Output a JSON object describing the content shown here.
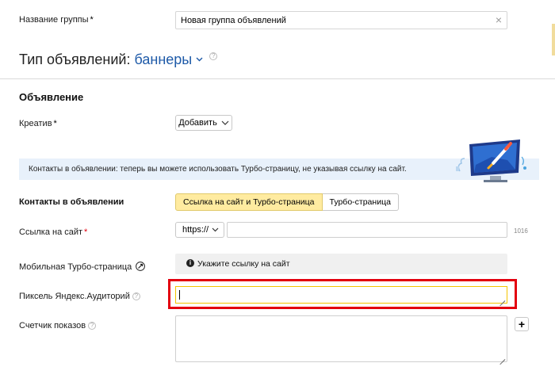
{
  "group": {
    "label": "Название группы",
    "required_mark": "*",
    "value": "Новая группа объявлений",
    "clear_glyph": "×"
  },
  "ad_type": {
    "prefix": "Тип объявлений:",
    "value": "баннеры",
    "help": "?"
  },
  "ad_section_title": "Объявление",
  "creative": {
    "label": "Креатив",
    "required_mark": "*",
    "add_button": "Добавить"
  },
  "info_banner": {
    "text": "Контакты в объявлении: теперь вы можете использовать Турбо-страницу, не указывая ссылку на сайт."
  },
  "contacts": {
    "label": "Контакты в объявлении",
    "tabs": [
      {
        "label": "Ссылка на сайт и Турбо-страница",
        "active": true
      },
      {
        "label": "Турбо-страница",
        "active": false
      }
    ]
  },
  "site_link": {
    "label": "Ссылка на сайт",
    "required_mark": "*",
    "protocol": "https://",
    "value": "",
    "counter": "1016"
  },
  "turbo_page": {
    "label": "Мобильная Турбо-страница",
    "icon": "rocket-icon",
    "notice": "Укажите ссылку на сайт"
  },
  "pixel": {
    "label": "Пиксель Яндекс.Аудиторий",
    "help": "?",
    "value": ""
  },
  "counter": {
    "label": "Счетчик показов",
    "help": "?",
    "value": "",
    "add_glyph": "+"
  },
  "colors": {
    "highlight_border": "#e3000f",
    "active_tab_bg": "#ffeba0",
    "info_bg": "#e8f1fb",
    "link": "#1e5aa8",
    "focus_border": "#f5c400"
  }
}
